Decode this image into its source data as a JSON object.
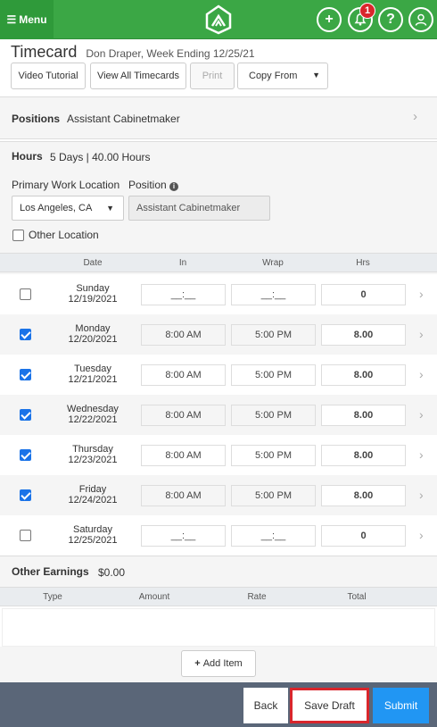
{
  "header": {
    "menu_label": "Menu",
    "notification_count": "1",
    "colors": {
      "brand": "#3ba745",
      "badge": "#d9262c"
    }
  },
  "page": {
    "title": "Timecard",
    "subtitle": "Don Draper, Week Ending 12/25/21"
  },
  "toolbar": {
    "video_tutorial": "Video Tutorial",
    "view_all": "View All Timecards",
    "print": "Print",
    "copy_from": "Copy From"
  },
  "positions": {
    "label": "Positions",
    "value": "Assistant Cabinetmaker"
  },
  "hours": {
    "label": "Hours",
    "summary": "5 Days | 40.00 Hours",
    "primary_location_label": "Primary Work Location",
    "primary_location_value": "Los Angeles, CA",
    "position_label": "Position",
    "position_value": "Assistant Cabinetmaker",
    "other_location_label": "Other Location"
  },
  "table": {
    "headers": {
      "date": "Date",
      "in": "In",
      "wrap": "Wrap",
      "hrs": "Hrs"
    },
    "rows": [
      {
        "day": "Sunday",
        "date": "12/19/2021",
        "in": "__:__",
        "wrap": "__:__",
        "hrs": "0",
        "checked": false
      },
      {
        "day": "Monday",
        "date": "12/20/2021",
        "in": "8:00 AM",
        "wrap": "5:00 PM",
        "hrs": "8.00",
        "checked": true
      },
      {
        "day": "Tuesday",
        "date": "12/21/2021",
        "in": "8:00 AM",
        "wrap": "5:00 PM",
        "hrs": "8.00",
        "checked": true
      },
      {
        "day": "Wednesday",
        "date": "12/22/2021",
        "in": "8:00 AM",
        "wrap": "5:00 PM",
        "hrs": "8.00",
        "checked": true
      },
      {
        "day": "Thursday",
        "date": "12/23/2021",
        "in": "8:00 AM",
        "wrap": "5:00 PM",
        "hrs": "8.00",
        "checked": true
      },
      {
        "day": "Friday",
        "date": "12/24/2021",
        "in": "8:00 AM",
        "wrap": "5:00 PM",
        "hrs": "8.00",
        "checked": true
      },
      {
        "day": "Saturday",
        "date": "12/25/2021",
        "in": "__:__",
        "wrap": "__:__",
        "hrs": "0",
        "checked": false
      }
    ]
  },
  "other_earnings": {
    "label": "Other Earnings",
    "total": "$0.00",
    "headers": {
      "type": "Type",
      "amount": "Amount",
      "rate": "Rate",
      "total": "Total"
    },
    "add_item": "Add Item"
  },
  "footer": {
    "back": "Back",
    "save_draft": "Save Draft",
    "submit": "Submit",
    "colors": {
      "submit": "#2196f3",
      "highlight": "#d9262c"
    }
  }
}
